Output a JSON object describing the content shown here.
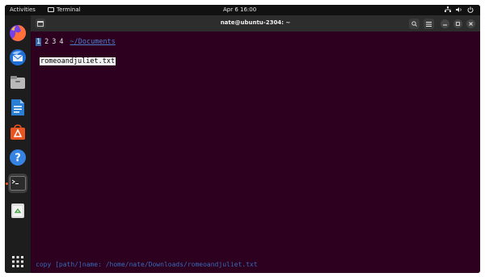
{
  "topbar": {
    "activities": "Activities",
    "app_name": "Terminal",
    "clock": "Apr 6  16:00",
    "tray_icons": [
      "network-icon",
      "volume-icon",
      "power-icon"
    ]
  },
  "dock": {
    "items": [
      {
        "name": "firefox",
        "icon": "firefox-icon"
      },
      {
        "name": "thunderbird",
        "icon": "thunderbird-icon"
      },
      {
        "name": "files",
        "icon": "files-icon"
      },
      {
        "name": "libreoffice-writer",
        "icon": "writer-icon"
      },
      {
        "name": "software",
        "icon": "software-icon"
      },
      {
        "name": "help",
        "icon": "help-icon"
      },
      {
        "name": "terminal",
        "icon": "terminal-icon",
        "active": true
      },
      {
        "name": "trash",
        "icon": "trash-icon"
      }
    ],
    "apps_grid": "show-apps-icon"
  },
  "terminal": {
    "title": "nate@ubuntu-2304: ~",
    "tabs": [
      "1",
      "2",
      "3",
      "4"
    ],
    "current_tab": "1",
    "path": "~/Documents",
    "file": "romeoandjuliet.txt",
    "status": "copy [path/]name: /home/nate/Downloads/romeoandjuliet.txt",
    "buttons": {
      "search": "search-icon",
      "menu": "menu-icon",
      "minimize": "minimize-icon",
      "maximize": "maximize-icon",
      "close": "close-icon"
    }
  },
  "colors": {
    "terminal_bg": "#2c001e",
    "path_link": "#4e7fce",
    "status_text": "#3a6ab8",
    "tab_highlight": "#3465a4",
    "accent": "#e95420"
  }
}
